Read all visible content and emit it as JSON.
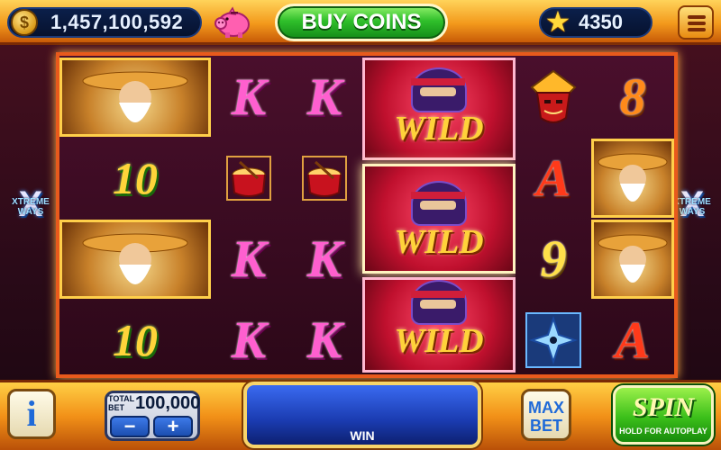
{
  "header": {
    "coins": "1,457,100,592",
    "coin_icon_glyph": "$",
    "buy_label": "BUY COINS",
    "level": "4350",
    "star_glyph": "★"
  },
  "reels": [
    [
      "sage",
      "10",
      "sage",
      "10"
    ],
    [
      "K",
      "drum",
      "K",
      "K"
    ],
    [
      "K",
      "drum",
      "K",
      "K"
    ],
    [
      "wild",
      "wild",
      "wild"
    ],
    [
      "samurai-mask",
      "A",
      "9",
      "shuriken"
    ],
    [
      "8",
      "sage",
      "sage",
      "A"
    ]
  ],
  "symbols": {
    "wild_label": "WILD",
    "ten": "10",
    "K": "K",
    "A": "A",
    "8": "8",
    "9": "9"
  },
  "side_badges": {
    "line1": "XTREME",
    "line2": "WAYS",
    "mark": "X"
  },
  "bottom": {
    "info_label": "i",
    "total_bet_label": "TOTAL BET",
    "bet_value": "100,000",
    "minus": "−",
    "plus": "+",
    "win_label": "WIN",
    "max_bet_line1": "MAX",
    "max_bet_line2": "BET",
    "spin_label": "SPIN",
    "spin_sub": "HOLD FOR AUTOPLAY"
  },
  "colors": {
    "frame": "#e85a1c",
    "accent_gold": "#ffcf45",
    "buy_green": "#2fbf2a",
    "win_blue": "#1a3bb0"
  }
}
